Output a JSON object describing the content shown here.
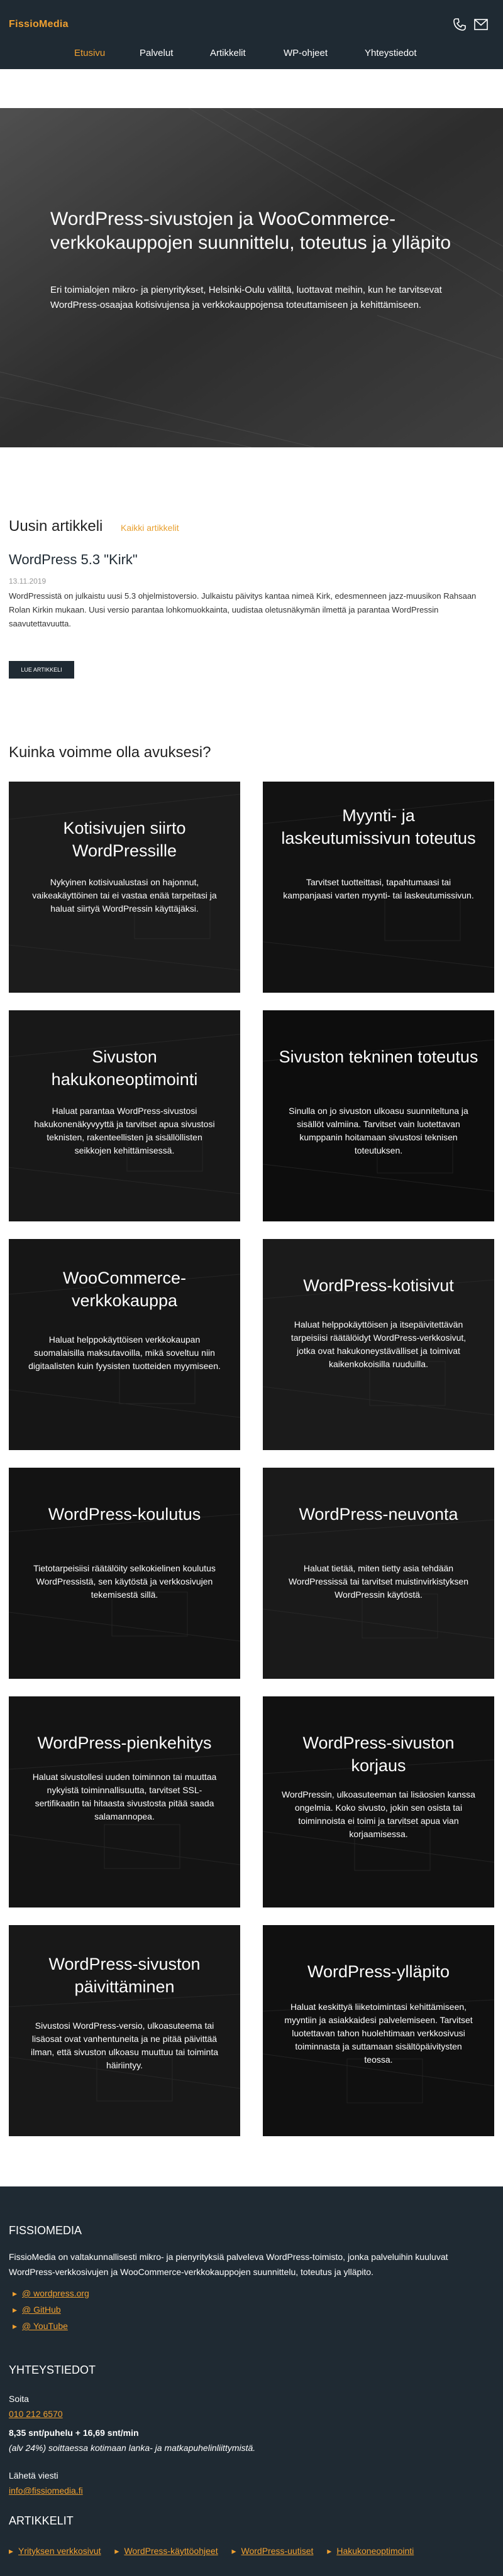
{
  "header": {
    "brand": "FissioMedia",
    "nav": [
      "Etusivu",
      "Palvelut",
      "Artikkelit",
      "WP-ohjeet",
      "Yhteystiedot"
    ],
    "accent": "#f0a030",
    "bg": "#1f2a33",
    "icons": [
      "phone-icon",
      "mail-icon"
    ]
  },
  "hero": {
    "title": "WordPress-sivustojen ja WooCommerce-verkkokauppojen suunnittelu, toteutus ja ylläpito",
    "text": "Eri toimialojen mikro- ja pienyritykset, Helsinki-Oulu väliltä, luottavat meihin, kun he tarvitsevat WordPress-osaajaa kotisivujensa ja verkkokauppojensa toteuttamiseen ja kehittämiseen."
  },
  "latest": {
    "title": "Uusin artikkeli",
    "all_link": "Kaikki artikkelit",
    "post_title": "WordPress 5.3 \"Kirk\"",
    "post_date": "13.11.2019",
    "excerpt": "WordPressistä on julkaistu uusi 5.3 ohjelmistoversio. Julkaistu päivitys kantaa nimeä Kirk, edesmenneen jazz-muusikon Rahsaan Rolan Kirkin mukaan. Uusi versio parantaa lohkomuokkainta, uudistaa oletusnäkymän ilmettä ja parantaa WordPressin saavutettavuutta.",
    "button": "LUE ARTIKKELI"
  },
  "services": {
    "title": "Kuinka voimme olla avuksesi?",
    "cards": [
      {
        "title": "Kotisivujen siirto WordPressille",
        "text": "Nykyinen kotisivualustasi on hajonnut, vaikeakäyttöinen tai ei vastaa enää tarpeitasi ja haluat siirtyä WordPressin käyttäjäksi."
      },
      {
        "title": "Myynti- ja laskeutumissivun toteutus",
        "text": "Tarvitset tuotteittasi, tapahtumaasi tai kampanjaasi varten myynti- tai laskeutumissivun."
      },
      {
        "title": "Sivuston hakukoneoptimointi",
        "text": "Haluat parantaa WordPress-sivustosi hakukonenäkyvyyttä ja tarvitset apua sivustosi teknisten, rakenteellisten ja sisällöllisten seikkojen kehittämisessä."
      },
      {
        "title": "Sivuston tekninen toteutus",
        "text": "Sinulla on jo sivuston ulkoasu suunniteltuna ja sisällöt valmiina. Tarvitset vain luotettavan kumppanin hoitamaan sivustosi teknisen toteutuksen."
      },
      {
        "title": "WooCommerce-verkkokauppa",
        "text": "Haluat helppokäyttöisen verkkokaupan suomalaisilla maksutavoilla, mikä soveltuu niin digitaalisten kuin fyysisten tuotteiden myymiseen."
      },
      {
        "title": "WordPress-kotisivut",
        "text": "Haluat helppokäyttöisen ja itsepäivitettävän tarpeisiisi räätälöidyt WordPress-verkkosivut, jotka ovat hakukoneystävälliset ja toimivat kaikenkokoisilla ruuduilla."
      },
      {
        "title": "WordPress-koulutus",
        "text": "Tietotarpeisiisi räätälöity selkokielinen koulutus WordPressistä, sen käytöstä ja verkkosivujen tekemisestä sillä."
      },
      {
        "title": "WordPress-neuvonta",
        "text": "Haluat tietää, miten tietty asia tehdään WordPressissä tai tarvitset muistinvirkistyksen WordPressin käytöstä."
      },
      {
        "title": "WordPress-pienkehitys",
        "text": "Haluat sivustollesi uuden toiminnon tai muuttaa nykyistä toiminnallisuutta, tarvitset SSL-sertifikaatin tai hitaasta sivustosta pitää saada salamannopea."
      },
      {
        "title": "WordPress-sivuston korjaus",
        "text": "WordPressin, ulkoasuteeman tai lisäosien kanssa ongelmia. Koko sivusto, jokin sen osista tai toiminnoista ei toimi ja tarvitset apua vian korjaamisessa."
      },
      {
        "title": "WordPress-sivuston päivittäminen",
        "text": "Sivustosi WordPress-versio, ulkoasuteema tai lisäosat ovat vanhentuneita ja ne pitää päivittää ilman, että sivuston ulkoasu muuttuu tai toiminta häiriintyy."
      },
      {
        "title": "WordPress-ylläpito",
        "text": "Haluat keskittyä liiketoimintasi kehittämiseen, myyntiin ja asiakkaidesi palvelemiseen. Tarvitset luotettavan tahon huolehtimaan verkkosivusi toiminnasta ja suttamaan sisältöpäivitysten teossa."
      }
    ]
  },
  "footer": {
    "brand_head": "FISSIOMEDIA",
    "about": "FissioMedia on valtakunnallisesti mikro- ja pienyrityksiä palveleva WordPress-toimisto, jonka palveluihin kuuluvat WordPress-verkkosivujen ja WooCommerce-verkkokauppojen suunnittelu, toteutus ja ylläpito.",
    "links": [
      "@ wordpress.org",
      "@ GitHub",
      "@ YouTube"
    ],
    "contact_head": "YHTEYSTIEDOT",
    "call_label": "Soita",
    "phone": "010 212 6570",
    "price": "8,35 snt/puhelu + 16,69 snt/min",
    "price_note": "(alv 24%) soittaessa kotimaan lanka- ja matkapuhelinliittymistä.",
    "mail_label": "Lähetä viesti",
    "email": "info@fissiomedia.fi",
    "articles_head": "ARTIKKELIT",
    "article_links": [
      "Yrityksen verkkosivut",
      "WordPress-käyttöohjeet",
      "WordPress-uutiset",
      "Hakukoneoptimointi"
    ]
  }
}
